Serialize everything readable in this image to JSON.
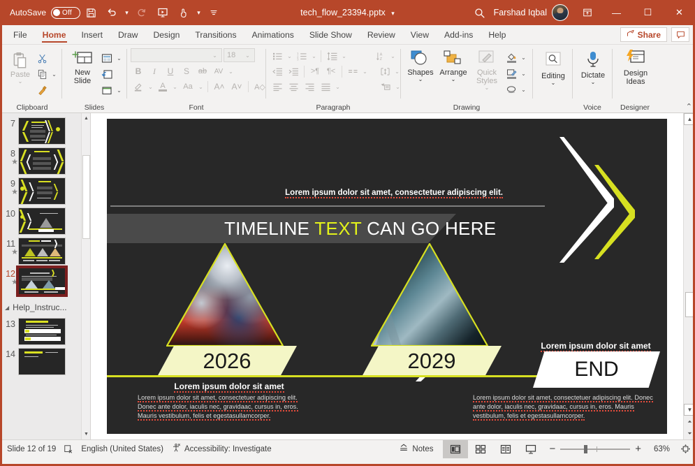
{
  "titlebar": {
    "autosave_label": "AutoSave",
    "autosave_state": "Off",
    "save_icon": "save-icon",
    "undo_icon": "undo-icon",
    "redo_icon": "redo-icon",
    "present_icon": "start-presentation-icon",
    "touch_icon": "touch-mode-icon",
    "more_icon": "customize-quick-access-icon",
    "document_title": "tech_flow_23394.pptx",
    "title_caret": "▾",
    "search_icon": "search-icon",
    "account_name": "Farshad Iqbal",
    "avatar": "user-avatar",
    "ribbon_display_icon": "ribbon-display-options-icon",
    "minimize": "—",
    "maximize": "☐",
    "close": "✕"
  },
  "tabs": [
    {
      "label": "File",
      "active": false
    },
    {
      "label": "Home",
      "active": true
    },
    {
      "label": "Insert",
      "active": false
    },
    {
      "label": "Draw",
      "active": false
    },
    {
      "label": "Design",
      "active": false
    },
    {
      "label": "Transitions",
      "active": false
    },
    {
      "label": "Animations",
      "active": false
    },
    {
      "label": "Slide Show",
      "active": false
    },
    {
      "label": "Review",
      "active": false
    },
    {
      "label": "View",
      "active": false
    },
    {
      "label": "Add-ins",
      "active": false
    },
    {
      "label": "Help",
      "active": false
    }
  ],
  "tabbar": {
    "share_label": "Share",
    "share_icon": "share-icon",
    "comments_icon": "comments-icon"
  },
  "ribbon": {
    "collapse_icon": "⌃",
    "groups": [
      {
        "title": "Clipboard",
        "paste_label": "Paste",
        "cut_icon": "scissors-icon",
        "copy_icon": "copy-icon",
        "format_painter_icon": "format-painter-icon"
      },
      {
        "title": "Slides",
        "new_slide_label": "New\nSlide",
        "layout_icon": "slide-layout-icon",
        "reset_icon": "reset-slide-icon",
        "section_icon": "section-icon"
      },
      {
        "title": "Font",
        "font_name_value": "",
        "font_size_value": "18",
        "bold": "B",
        "italic": "I",
        "underline": "U",
        "shadow": "S",
        "strikethrough": "ab",
        "char_spacing": "AV",
        "text_highlight_icon": "text-highlight-icon",
        "font_color_icon": "font-color-icon",
        "change_case": "Aa",
        "grow_font": "A˄",
        "shrink_font": "A˅",
        "clear_formatting": "A◇"
      },
      {
        "title": "Paragraph",
        "bullets_icon": "bullets-icon",
        "numbering_icon": "numbering-icon",
        "line_spacing_icon": "line-spacing-icon",
        "text_direction_icon": "text-direction-icon",
        "decrease_indent_icon": "decrease-indent-icon",
        "increase_indent_icon": "increase-indent-icon",
        "ltr_icon": "left-to-right-icon",
        "rtl_icon": "right-to-left-icon",
        "columns_icon": "columns-icon",
        "align_text_icon": "align-text-icon",
        "align_left_icon": "align-left-icon",
        "align_center_icon": "align-center-icon",
        "align_right_icon": "align-right-icon",
        "justify_icon": "justify-icon",
        "smartart_icon": "convert-to-smartart-icon"
      },
      {
        "title": "Drawing",
        "shapes_label": "Shapes",
        "arrange_label": "Arrange",
        "quick_styles_label": "Quick\nStyles",
        "shape_fill_icon": "shape-fill-icon",
        "shape_outline_icon": "shape-outline-icon",
        "shape_effects_icon": "shape-effects-icon"
      },
      {
        "title": "",
        "editing_label": "Editing",
        "editing_icon": "find-icon"
      },
      {
        "title": "Voice",
        "dictate_label": "Dictate",
        "dictate_icon": "microphone-icon"
      },
      {
        "title": "Designer",
        "design_ideas_label": "Design\nIdeas",
        "design_ideas_icon": "design-ideas-icon"
      }
    ]
  },
  "thumbnails": {
    "scroll_up_icon": "▲",
    "scroll_down_icon": "▼",
    "items": [
      {
        "number": "7",
        "starred": false,
        "selected": false,
        "style": "chevrons-left"
      },
      {
        "number": "8",
        "starred": true,
        "selected": false,
        "style": "hex"
      },
      {
        "number": "9",
        "starred": true,
        "selected": false,
        "style": "chevrons-right"
      },
      {
        "number": "10",
        "starred": false,
        "selected": false,
        "style": "pyramid-one"
      },
      {
        "number": "11",
        "starred": true,
        "selected": false,
        "style": "pyramid-three"
      },
      {
        "number": "12",
        "starred": true,
        "selected": true,
        "style": "pyramid-two"
      }
    ],
    "section": {
      "collapse_icon": "◢",
      "name": "Help_Instruc..."
    },
    "section_items": [
      {
        "number": "13",
        "starred": false,
        "selected": false,
        "style": "help-doc"
      },
      {
        "number": "14",
        "starred": false,
        "selected": false,
        "style": "help-doc2"
      }
    ]
  },
  "slide": {
    "subtitle": "Lorem ipsum dolor sit amet, consectetuer adipiscing elit.",
    "band_text_before": "TIMELINE ",
    "band_text_highlight": "TEXT",
    "band_text_after": " CAN GO HERE",
    "milestones": [
      {
        "year": "2026",
        "caption_title": "Lorem ipsum dolor sit amet",
        "caption_body": "Lorem ipsum dolor sit amet, consectetuer adipiscing elit. Donec ante dolor, iaculis nec, gravidaac, cursus in, eros. Mauris vestibulum, felis et egestasullamcorper.",
        "image": "chess-pieces-photo"
      },
      {
        "year": "2029",
        "caption_title": "Lorem ipsum dolor sit amet",
        "caption_body": "Lorem ipsum dolor sit amet, consectetuer adipiscing elit. Donec ante dolor, iaculis nec, gravidaac, cursus in, eros. Mauris vestibulum, felis et egestasullamcorper.",
        "image": "glass-skyscraper-photo"
      }
    ],
    "end_banner": "END",
    "colors": {
      "background": "#282828",
      "accent_yellow": "#d7e021",
      "band_gray": "#4a4a4a",
      "pyramid_band": "#f4f6c6"
    }
  },
  "statusbar": {
    "slide_counter": "Slide 12 of 19",
    "no_notes_icon": "no-slide-notes-icon",
    "language": "English (United States)",
    "accessibility_icon": "accessibility-icon",
    "accessibility": "Accessibility: Investigate",
    "notes_label": "Notes",
    "notes_icon": "notes-icon",
    "view_normal_icon": "normal-view-icon",
    "view_sorter_icon": "slide-sorter-icon",
    "view_reading_icon": "reading-view-icon",
    "view_slideshow_icon": "slide-show-icon",
    "zoom_out": "−",
    "zoom_in": "+",
    "zoom_level": "63%",
    "fit_icon": "fit-slide-to-window-icon"
  }
}
